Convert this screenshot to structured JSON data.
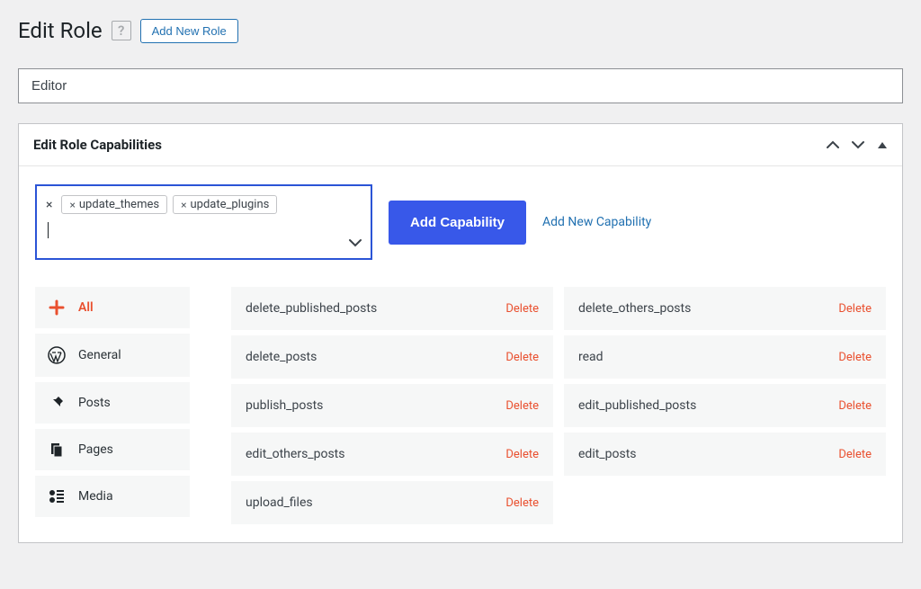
{
  "header": {
    "title": "Edit Role",
    "add_new_label": "Add New Role"
  },
  "role_name": "Editor",
  "panel": {
    "title": "Edit Role Capabilities"
  },
  "tags": [
    "update_themes",
    "update_plugins"
  ],
  "add_capability_btn": "Add Capability",
  "add_new_capability_link": "Add New Capability",
  "nav": [
    {
      "label": "All",
      "icon": "plus",
      "active": true
    },
    {
      "label": "General",
      "icon": "wordpress"
    },
    {
      "label": "Posts",
      "icon": "pin"
    },
    {
      "label": "Pages",
      "icon": "pages"
    },
    {
      "label": "Media",
      "icon": "media"
    }
  ],
  "capabilities_col1": [
    "delete_published_posts",
    "delete_posts",
    "publish_posts",
    "edit_others_posts",
    "upload_files"
  ],
  "capabilities_col2": [
    "delete_others_posts",
    "read",
    "edit_published_posts",
    "edit_posts"
  ],
  "delete_label": "Delete"
}
